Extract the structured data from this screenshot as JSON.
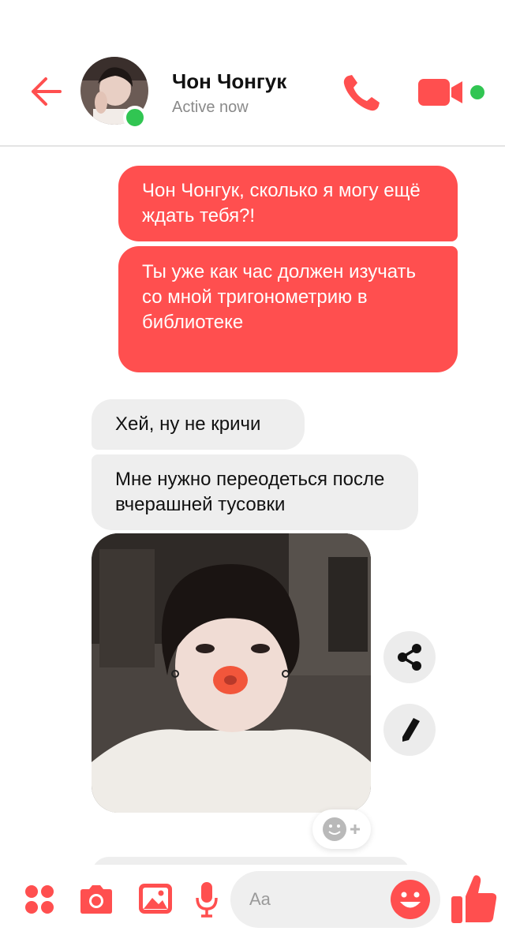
{
  "header": {
    "contact_name": "Чон Чонгук",
    "status": "Active now"
  },
  "messages": [
    {
      "direction": "outgoing",
      "text": "Чон Чонгук, сколько я могу ещё ждать тебя?!"
    },
    {
      "direction": "outgoing",
      "text": "Ты уже как час должен изучать со мной тригонометрию в библиотеке"
    },
    {
      "direction": "incoming",
      "text": "Хей, ну не кричи"
    },
    {
      "direction": "incoming",
      "text": "Мне нужно переодеться после вчерашней тусовки"
    }
  ],
  "composer": {
    "placeholder": "Aa"
  },
  "colors": {
    "accent": "#ff4f4f",
    "online": "#31c552",
    "incoming_bubble": "#eeeeee"
  },
  "icons": [
    "back-arrow-icon",
    "phone-icon",
    "video-camera-icon",
    "share-icon",
    "pencil-icon",
    "add-reaction-icon",
    "apps-icon",
    "camera-icon",
    "image-icon",
    "microphone-icon",
    "emoji-icon",
    "thumbs-up-icon"
  ]
}
